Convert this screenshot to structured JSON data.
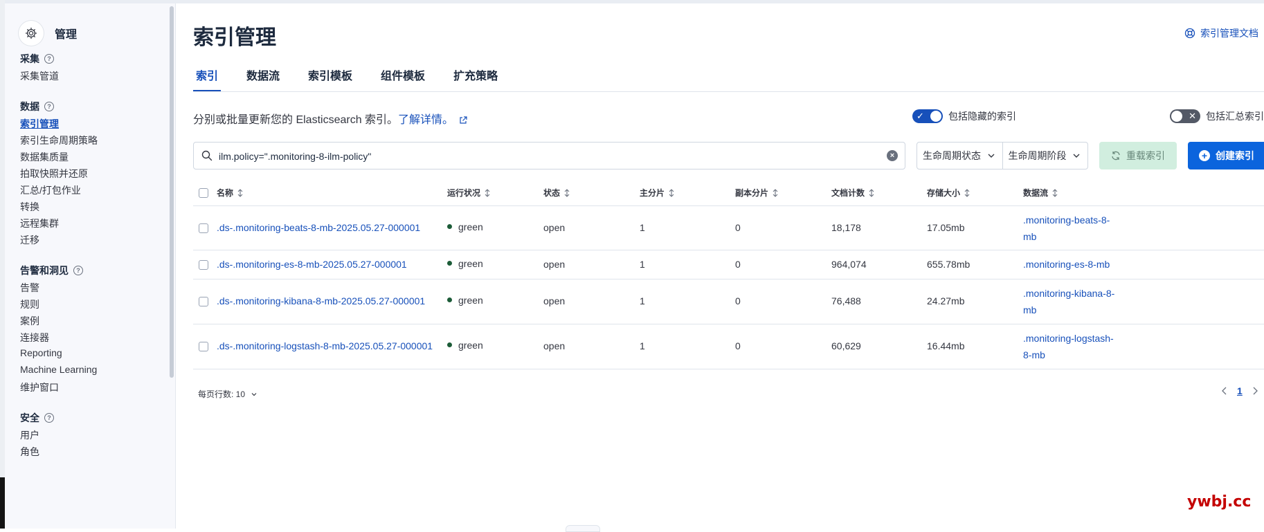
{
  "sidebar": {
    "title": "管理",
    "sections": {
      "ingest": {
        "title": "采集",
        "items": [
          "采集管道"
        ]
      },
      "data": {
        "title": "数据",
        "items": [
          "索引管理",
          "索引生命周期策略",
          "数据集质量",
          "拍取快照并还原",
          "汇总/打包作业",
          "转换",
          "远程集群",
          "迁移"
        ]
      },
      "alerts": {
        "title": "告警和洞见",
        "items": [
          "告警",
          "规则",
          "案例",
          "连接器",
          "Reporting",
          "Machine Learning",
          "维护窗口"
        ]
      },
      "security": {
        "title": "安全",
        "items": [
          "用户",
          "角色"
        ]
      }
    }
  },
  "header": {
    "title": "索引管理",
    "doc_link": "索引管理文档"
  },
  "tabs": [
    "索引",
    "数据流",
    "索引模板",
    "组件模板",
    "扩充策略"
  ],
  "description": {
    "text": "分别或批量更新您的 Elasticsearch 索引。",
    "link": "了解详情。"
  },
  "toggles": {
    "hidden": {
      "label": "包括隐藏的索引",
      "on": true
    },
    "rollup": {
      "label": "包括汇总索引",
      "on": false
    }
  },
  "search": {
    "value": "ilm.policy=\".monitoring-8-ilm-policy\""
  },
  "filters": [
    "生命周期状态",
    "生命周期阶段"
  ],
  "buttons": {
    "reload": "重载索引",
    "create": "创建索引"
  },
  "table": {
    "columns": [
      "名称",
      "运行状况",
      "状态",
      "主分片",
      "副本分片",
      "文档计数",
      "存储大小",
      "数据流"
    ],
    "rows": [
      {
        "name": ".ds-.monitoring-beats-8-mb-2025.05.27-000001",
        "health": "green",
        "status": "open",
        "primary": "1",
        "replica": "0",
        "docs": "18,178",
        "size": "17.05mb",
        "stream": ".monitoring-beats-8-mb"
      },
      {
        "name": ".ds-.monitoring-es-8-mb-2025.05.27-000001",
        "health": "green",
        "status": "open",
        "primary": "1",
        "replica": "0",
        "docs": "964,074",
        "size": "655.78mb",
        "stream": ".monitoring-es-8-mb"
      },
      {
        "name": ".ds-.monitoring-kibana-8-mb-2025.05.27-000001",
        "health": "green",
        "status": "open",
        "primary": "1",
        "replica": "0",
        "docs": "76,488",
        "size": "24.27mb",
        "stream": ".monitoring-kibana-8-mb"
      },
      {
        "name": ".ds-.monitoring-logstash-8-mb-2025.05.27-000001",
        "health": "green",
        "status": "open",
        "primary": "1",
        "replica": "0",
        "docs": "60,629",
        "size": "16.44mb",
        "stream": ".monitoring-logstash-8-mb"
      }
    ]
  },
  "pagination": {
    "rows_per_page": "每页行数: 10",
    "current_page": "1"
  },
  "watermark": "ywbj.cc",
  "colors": {
    "accent": "#1750ba",
    "primary_button": "#0b64dd",
    "success_button": "#d1eedf",
    "health_green": "#1c5c38"
  },
  "icons": [
    "gear-icon",
    "help-icon",
    "docs-icon",
    "external-link-icon",
    "search-icon",
    "clear-icon",
    "chevron-down-icon",
    "refresh-icon",
    "plus-icon",
    "sort-icon",
    "chevron-left-icon",
    "chevron-right-icon"
  ]
}
